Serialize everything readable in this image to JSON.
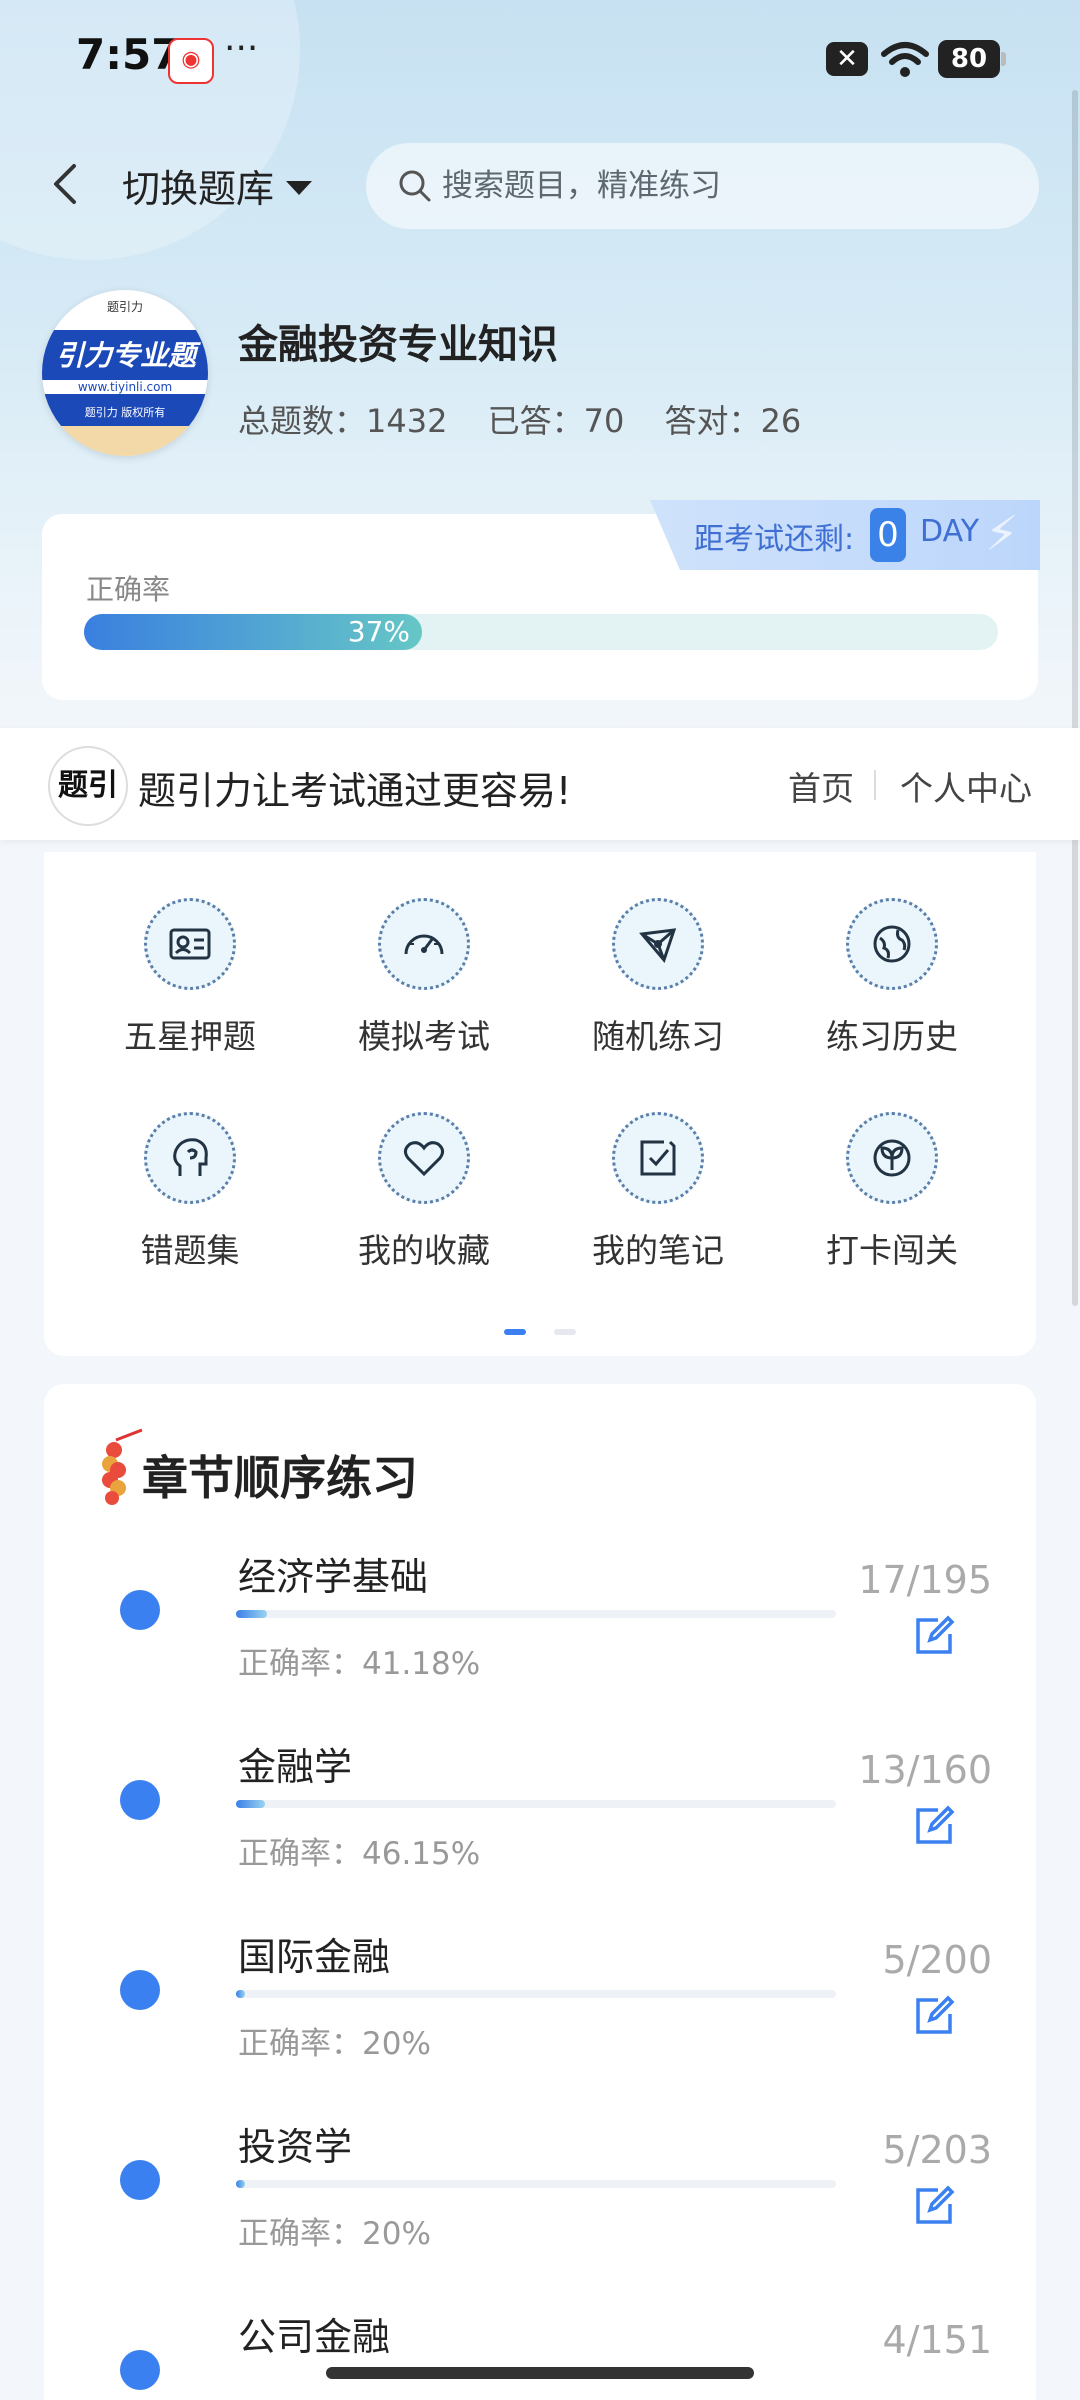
{
  "status_bar": {
    "time": "7:57",
    "more": "···",
    "battery": "80"
  },
  "topnav": {
    "switch_label": "切换题库",
    "search_placeholder": "搜索题目，精准练习"
  },
  "bank": {
    "title": "金融投资专业知识",
    "total_label": "总题数：1432",
    "answered_label": "已答：70",
    "correct_label": "答对：26",
    "logo_text": "引力专业题",
    "logo_url": "www.tiyinli.com",
    "logo_copy": "题引力 版权所有",
    "logo_top": "题引力"
  },
  "accuracy": {
    "label": "正确率",
    "percent_text": "37%",
    "fraction": 0.37
  },
  "exam_countdown": {
    "label": "距考试还剩:",
    "days": "0",
    "unit": "DAY"
  },
  "promo": {
    "logo_text": "题引",
    "slogan": "题引力让考试通过更容易!",
    "home": "首页",
    "personal": "个人中心"
  },
  "features": [
    {
      "label": "五星押题",
      "icon": "id-card-icon"
    },
    {
      "label": "模拟考试",
      "icon": "speedometer-icon"
    },
    {
      "label": "随机练习",
      "icon": "network-icon"
    },
    {
      "label": "练习历史",
      "icon": "globe-icon"
    },
    {
      "label": "错题集",
      "icon": "head-icon"
    },
    {
      "label": "我的收藏",
      "icon": "heart-icon"
    },
    {
      "label": "我的笔记",
      "icon": "note-check-icon"
    },
    {
      "label": "打卡闯关",
      "icon": "sprout-icon"
    }
  ],
  "chapter_section": {
    "title": "章节顺序练习",
    "items": [
      {
        "name": "经济学基础",
        "accuracy": "正确率：41.18%",
        "count": "17/195",
        "progress": 0.087
      },
      {
        "name": "金融学",
        "accuracy": "正确率：46.15%",
        "count": "13/160",
        "progress": 0.081
      },
      {
        "name": "国际金融",
        "accuracy": "正确率：20%",
        "count": "5/200",
        "progress": 0.025
      },
      {
        "name": "投资学",
        "accuracy": "正确率：20%",
        "count": "5/203",
        "progress": 0.025
      },
      {
        "name": "公司金融",
        "accuracy": "",
        "count": "4/151",
        "progress": 0.026
      }
    ]
  },
  "colors": {
    "accent": "#3a80f0",
    "teal": "#66c7c6"
  }
}
